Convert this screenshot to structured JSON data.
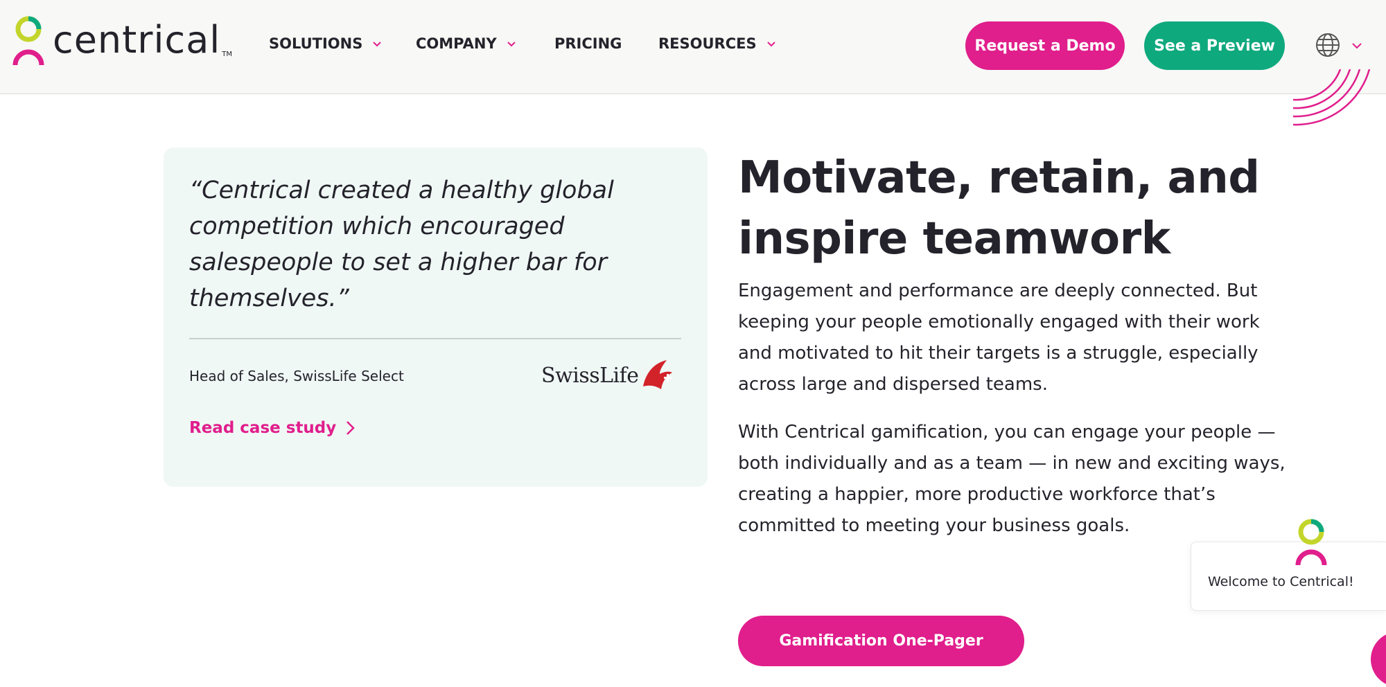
{
  "header": {
    "logo_text": "centrical",
    "logo_tm": "TM",
    "nav": [
      {
        "label": "SOLUTIONS",
        "has_dropdown": true
      },
      {
        "label": "COMPANY",
        "has_dropdown": true
      },
      {
        "label": "PRICING",
        "has_dropdown": false
      },
      {
        "label": "RESOURCES",
        "has_dropdown": true
      }
    ],
    "request_demo_label": "Request a Demo",
    "see_preview_label": "See a Preview",
    "language_icon": "globe-icon"
  },
  "testimonial": {
    "quote": "“Centrical created a healthy global competition which encouraged salespeople to set a higher bar for themselves.”",
    "attribution": "Head of Sales, SwissLife Select",
    "company_logo_text": "SwissLife",
    "link_label": "Read case study"
  },
  "main": {
    "headline": "Motivate, retain, and inspire teamwork",
    "paragraph_1": "Engagement and performance are deeply connected. But keeping your people emotionally engaged with their work and motivated to hit their targets is a struggle, especially across large and dispersed teams.",
    "paragraph_2": "With Centrical gamification, you can engage your people — both individually and as a team — in new and exciting ways, creating a happier, more productive workforce that’s committed to meeting your business goals.",
    "cta_label": "Gamification One-Pager"
  },
  "chat": {
    "welcome_text": "Welcome to Centrical!"
  },
  "colors": {
    "brand_pink": "#e01e8c",
    "brand_green": "#0fa97e",
    "logo_lime": "#c3d52b",
    "card_bg": "#f0f8f6",
    "text_dark": "#24232b"
  }
}
